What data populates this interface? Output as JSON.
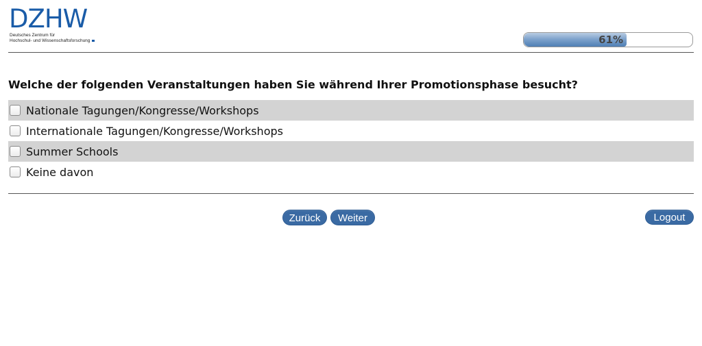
{
  "logo": {
    "mark": "DZHW",
    "line1": "Deutsches Zentrum für",
    "line2": "Hochschul- und Wissenschaftsforschung"
  },
  "progress": {
    "percent": 61,
    "label": "61%",
    "fill_color": "#4f7fb5"
  },
  "question": {
    "text": "Welche der folgenden Veranstaltungen haben Sie während Ihrer Promotionsphase besucht?"
  },
  "options": [
    {
      "label": "Nationale Tagungen/Kongresse/Workshops",
      "checked": false
    },
    {
      "label": "Internationale Tagungen/Kongresse/Workshops",
      "checked": false
    },
    {
      "label": "Summer Schools",
      "checked": false
    },
    {
      "label": "Keine davon",
      "checked": false
    }
  ],
  "navigation": {
    "back_label": "Zurück",
    "next_label": "Weiter",
    "logout_label": "Logout"
  },
  "colors": {
    "accent": "#3a6aa3",
    "brand": "#1a5ca8",
    "row_shade": "#d3d3d3"
  }
}
